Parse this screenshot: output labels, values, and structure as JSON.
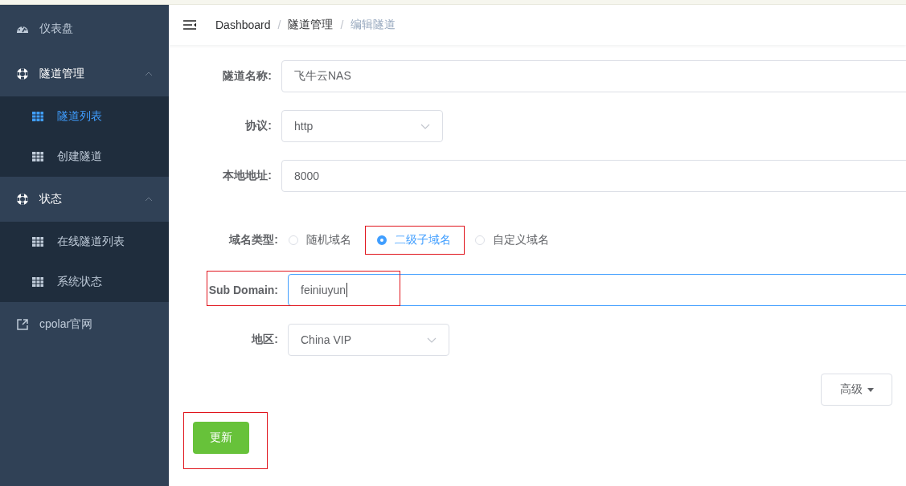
{
  "sidebar": {
    "items": [
      {
        "kind": "dashboard",
        "label": "仪表盘",
        "selected": false
      },
      {
        "kind": "group",
        "label": "隧道管理",
        "expanded": true,
        "children": [
          {
            "label": "隧道列表",
            "selected": true
          },
          {
            "label": "创建隧道",
            "selected": false
          }
        ]
      },
      {
        "kind": "group",
        "label": "状态",
        "expanded": true,
        "children": [
          {
            "label": "在线隧道列表",
            "selected": false
          },
          {
            "label": "系统状态",
            "selected": false
          }
        ]
      },
      {
        "kind": "external",
        "label": "cpolar官网",
        "selected": false
      }
    ]
  },
  "breadcrumb": [
    {
      "label": "Dashboard",
      "current": false
    },
    {
      "separator": "/",
      "label": "隧道管理",
      "current": false
    },
    {
      "separator": "/",
      "label": "编辑隧道",
      "current": true
    }
  ],
  "form": {
    "fields": [
      {
        "kind": "text",
        "label": "隧道名称:",
        "value": "飞牛云NAS",
        "highlighted": false,
        "focused": false
      },
      {
        "kind": "select",
        "label": "协议:",
        "value": "http",
        "highlighted": false
      },
      {
        "kind": "text",
        "label": "本地地址:",
        "value": "8000",
        "highlighted": false,
        "focused": false
      },
      {
        "kind": "radio",
        "label": "域名类型:",
        "options": [
          {
            "label": "随机域名",
            "selected": false,
            "highlighted": false
          },
          {
            "label": "二级子域名",
            "selected": true,
            "highlighted": true
          },
          {
            "label": "自定义域名",
            "selected": false,
            "highlighted": false
          }
        ]
      },
      {
        "kind": "text",
        "label": "Sub Domain:",
        "value": "feiniuyun",
        "highlighted": true,
        "focused": true
      },
      {
        "kind": "select",
        "label": "地区:",
        "value": "China VIP",
        "highlighted": false
      }
    ]
  },
  "advanced_button": {
    "label": "高级"
  },
  "submit_button": {
    "label": "更新",
    "highlighted": true
  }
}
